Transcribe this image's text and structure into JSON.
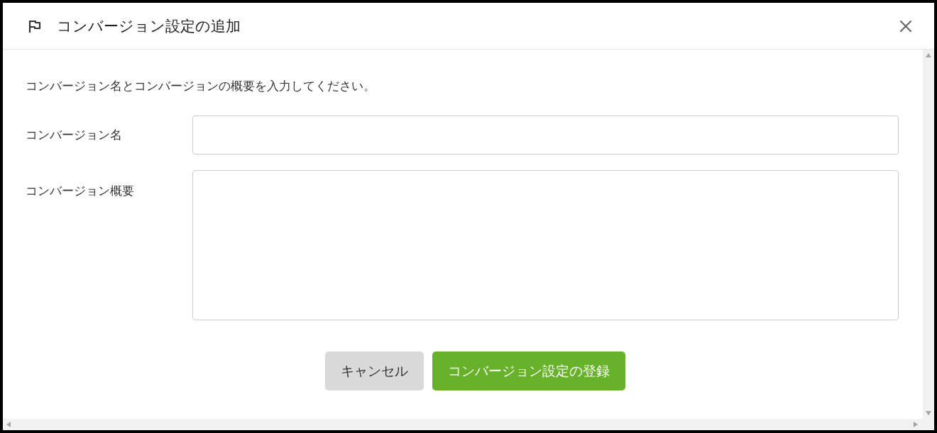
{
  "dialog": {
    "title": "コンバージョン設定の追加",
    "description": "コンバージョン名とコンバージョンの概要を入力してください。",
    "fields": [
      {
        "kind": "input",
        "label": "コンバージョン名"
      },
      {
        "kind": "textarea",
        "label": "コンバージョン概要"
      }
    ],
    "buttons": [
      {
        "kind": "secondary",
        "label": "キャンセル"
      },
      {
        "kind": "primary",
        "label": "コンバージョン設定の登録"
      }
    ]
  }
}
